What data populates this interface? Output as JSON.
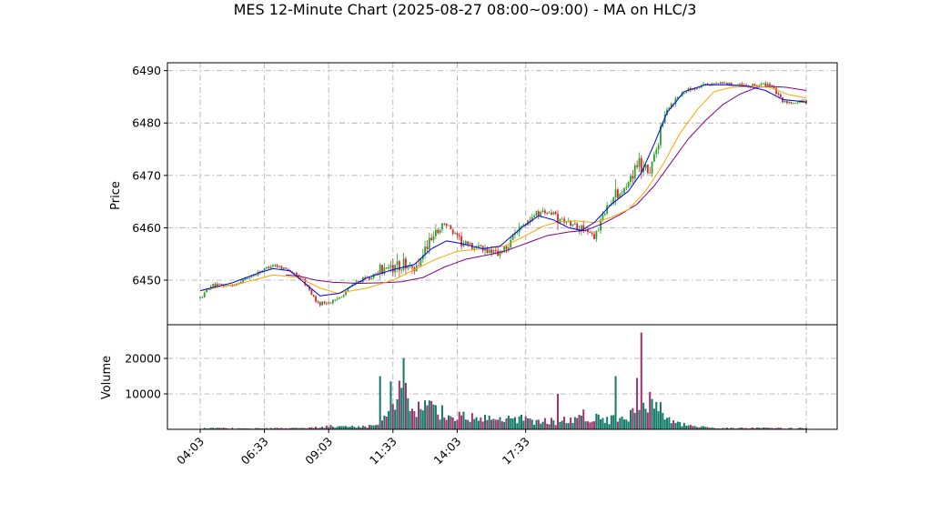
{
  "chart_data": {
    "type": "candlestick",
    "title": "MES 12-Minute Chart (2025-08-27 08:00~09:00) - MA on HLC/3",
    "price_panel": {
      "ylabel": "Price",
      "ylim": [
        6441.5,
        6491.5
      ],
      "yticks": [
        6450,
        6460,
        6470,
        6480,
        6490
      ],
      "grid": true
    },
    "volume_panel": {
      "ylabel": "Volume",
      "ylim": [
        0,
        29500
      ],
      "yticks": [
        10000,
        20000
      ],
      "grid": true
    },
    "xticks": [
      "04:03",
      "06:33",
      "09:03",
      "11:33",
      "14:03",
      "17:33",
      ""
    ],
    "colors": {
      "up": "#2ca02c",
      "down": "#d62728",
      "vol_up": "#117a65",
      "vol_down": "#a0306e",
      "ma_fast": "#0000ee",
      "ma_mid": "#ffa500",
      "ma_slow": "#800080",
      "grid": "#b0b0b0"
    },
    "price_anchors": [
      [
        0,
        6446.5
      ],
      [
        5,
        6449
      ],
      [
        15,
        6449
      ],
      [
        25,
        6451
      ],
      [
        34,
        6453
      ],
      [
        41,
        6452
      ],
      [
        48,
        6450
      ],
      [
        55,
        6445.5
      ],
      [
        63,
        6446
      ],
      [
        72,
        6449.5
      ],
      [
        82,
        6451
      ],
      [
        92,
        6453
      ],
      [
        100,
        6452
      ],
      [
        108,
        6458
      ],
      [
        114,
        6461
      ],
      [
        122,
        6457
      ],
      [
        132,
        6456
      ],
      [
        140,
        6455
      ],
      [
        150,
        6460
      ],
      [
        158,
        6463
      ],
      [
        165,
        6463
      ],
      [
        172,
        6461
      ],
      [
        178,
        6460
      ],
      [
        184,
        6458
      ],
      [
        190,
        6464
      ],
      [
        198,
        6467
      ],
      [
        205,
        6473
      ],
      [
        210,
        6470
      ],
      [
        218,
        6483
      ],
      [
        226,
        6486
      ],
      [
        236,
        6487.5
      ],
      [
        246,
        6487.5
      ],
      [
        256,
        6487
      ],
      [
        266,
        6487.5
      ],
      [
        272,
        6484
      ],
      [
        283,
        6484
      ]
    ],
    "volume_anchors": [
      [
        0,
        300
      ],
      [
        50,
        300
      ],
      [
        60,
        900
      ],
      [
        70,
        700
      ],
      [
        84,
        1000
      ],
      [
        95,
        13500
      ],
      [
        100,
        7000
      ],
      [
        110,
        5000
      ],
      [
        125,
        3200
      ],
      [
        140,
        2500
      ],
      [
        150,
        3000
      ],
      [
        160,
        2200
      ],
      [
        172,
        2500
      ],
      [
        180,
        3500
      ],
      [
        190,
        2800
      ],
      [
        200,
        3500
      ],
      [
        205,
        7000
      ],
      [
        212,
        9000
      ],
      [
        218,
        2500
      ],
      [
        228,
        900
      ],
      [
        240,
        400
      ],
      [
        283,
        300
      ]
    ],
    "volume_spikes": [
      [
        84,
        15000
      ],
      [
        89,
        13500
      ],
      [
        134,
        2600
      ],
      [
        167,
        10000
      ],
      [
        179,
        5600
      ],
      [
        194,
        15000
      ],
      [
        204,
        14500
      ],
      [
        206,
        27300
      ],
      [
        207,
        7500
      ]
    ],
    "ma_fast_anchors": [
      [
        0,
        6448
      ],
      [
        15,
        6449.5
      ],
      [
        28,
        6451.5
      ],
      [
        34,
        6452.2
      ],
      [
        42,
        6451.8
      ],
      [
        50,
        6449
      ],
      [
        56,
        6447
      ],
      [
        65,
        6447.5
      ],
      [
        78,
        6450.5
      ],
      [
        90,
        6452
      ],
      [
        100,
        6453
      ],
      [
        108,
        6456
      ],
      [
        115,
        6457.5
      ],
      [
        122,
        6457
      ],
      [
        132,
        6456
      ],
      [
        140,
        6456.5
      ],
      [
        150,
        6460
      ],
      [
        158,
        6462.3
      ],
      [
        165,
        6461.5
      ],
      [
        172,
        6460
      ],
      [
        178,
        6459.5
      ],
      [
        184,
        6461
      ],
      [
        192,
        6464.5
      ],
      [
        200,
        6467
      ],
      [
        206,
        6470.5
      ],
      [
        212,
        6476
      ],
      [
        218,
        6482
      ],
      [
        226,
        6486
      ],
      [
        236,
        6487.3
      ],
      [
        246,
        6487.3
      ],
      [
        256,
        6487
      ],
      [
        264,
        6486.2
      ],
      [
        272,
        6484.5
      ],
      [
        283,
        6484
      ]
    ],
    "ma_mid_anchors": [
      [
        0,
        6448
      ],
      [
        20,
        6449.5
      ],
      [
        34,
        6451
      ],
      [
        46,
        6450.5
      ],
      [
        56,
        6448.5
      ],
      [
        64,
        6447.5
      ],
      [
        78,
        6448.5
      ],
      [
        90,
        6450
      ],
      [
        100,
        6452
      ],
      [
        110,
        6454
      ],
      [
        120,
        6455.5
      ],
      [
        132,
        6456
      ],
      [
        142,
        6456.5
      ],
      [
        152,
        6458.5
      ],
      [
        160,
        6460.3
      ],
      [
        168,
        6461.2
      ],
      [
        176,
        6461.3
      ],
      [
        184,
        6461
      ],
      [
        192,
        6462
      ],
      [
        200,
        6463.5
      ],
      [
        208,
        6467
      ],
      [
        216,
        6472
      ],
      [
        224,
        6478
      ],
      [
        232,
        6482.5
      ],
      [
        240,
        6486
      ],
      [
        248,
        6486.8
      ],
      [
        258,
        6487
      ],
      [
        266,
        6486.8
      ],
      [
        274,
        6485.5
      ],
      [
        283,
        6484.8
      ]
    ],
    "ma_slow_anchors": [
      [
        40,
        6451
      ],
      [
        46,
        6450.8
      ],
      [
        54,
        6450
      ],
      [
        62,
        6449.6
      ],
      [
        74,
        6449.4
      ],
      [
        84,
        6449.5
      ],
      [
        94,
        6449.7
      ],
      [
        104,
        6450.5
      ],
      [
        114,
        6452.5
      ],
      [
        124,
        6454
      ],
      [
        134,
        6454.8
      ],
      [
        142,
        6455.5
      ],
      [
        152,
        6457
      ],
      [
        162,
        6458.5
      ],
      [
        172,
        6459.2
      ],
      [
        180,
        6459.5
      ],
      [
        188,
        6460.8
      ],
      [
        196,
        6462.5
      ],
      [
        204,
        6464.5
      ],
      [
        212,
        6468
      ],
      [
        220,
        6472.5
      ],
      [
        228,
        6477
      ],
      [
        236,
        6480.5
      ],
      [
        244,
        6483.5
      ],
      [
        252,
        6485.5
      ],
      [
        260,
        6486.8
      ],
      [
        266,
        6487
      ],
      [
        274,
        6486.8
      ],
      [
        283,
        6486.2
      ]
    ]
  }
}
